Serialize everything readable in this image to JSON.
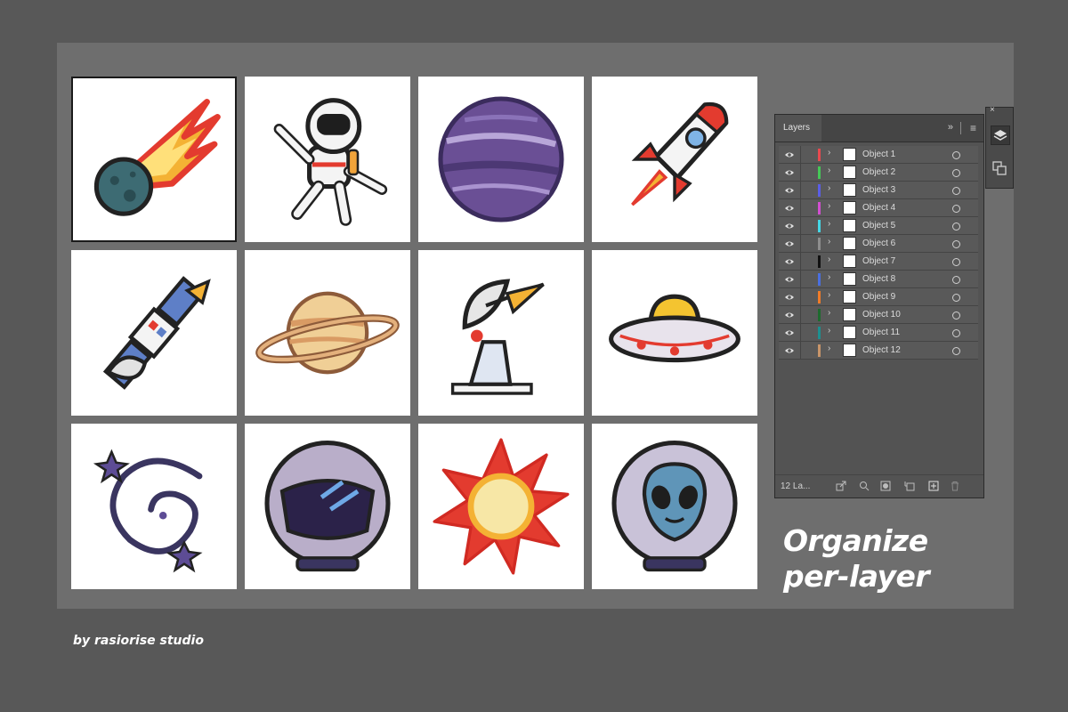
{
  "panel": {
    "tab_title": "Layers",
    "more_glyph": "»",
    "menu_glyph": "≡",
    "layer_count": "12 La...",
    "footer_icons": [
      "collect-export-icon",
      "locate-object-icon",
      "make-clipping-mask-icon",
      "new-sublayer-icon",
      "new-layer-icon",
      "delete-icon"
    ]
  },
  "layers": [
    {
      "name": "Object 1",
      "color": "#e8494f"
    },
    {
      "name": "Object 2",
      "color": "#45c857"
    },
    {
      "name": "Object 3",
      "color": "#5a5ee6"
    },
    {
      "name": "Object 4",
      "color": "#d24fd1"
    },
    {
      "name": "Object 5",
      "color": "#44d7e6"
    },
    {
      "name": "Object 6",
      "color": "#8e8e8e"
    },
    {
      "name": "Object 7",
      "color": "#111111"
    },
    {
      "name": "Object 8",
      "color": "#4a6fe0"
    },
    {
      "name": "Object 9",
      "color": "#f07b28"
    },
    {
      "name": "Object 10",
      "color": "#1e6b2e"
    },
    {
      "name": "Object 11",
      "color": "#1d8f8f"
    },
    {
      "name": "Object 12",
      "color": "#c8956a"
    }
  ],
  "artboards": [
    {
      "subject": "comet-icon",
      "selected": true
    },
    {
      "subject": "astronaut-icon",
      "selected": false
    },
    {
      "subject": "purple-planet-icon",
      "selected": false
    },
    {
      "subject": "rocket-icon",
      "selected": false
    },
    {
      "subject": "satellite-icon",
      "selected": false
    },
    {
      "subject": "ringed-planet-icon",
      "selected": false
    },
    {
      "subject": "radar-dish-icon",
      "selected": false
    },
    {
      "subject": "ufo-icon",
      "selected": false
    },
    {
      "subject": "galaxy-icon",
      "selected": false
    },
    {
      "subject": "space-helmet-icon",
      "selected": false
    },
    {
      "subject": "sun-icon",
      "selected": false
    },
    {
      "subject": "alien-helmet-icon",
      "selected": false
    }
  ],
  "dock": {
    "close_glyph": "×",
    "icons": [
      "layers-icon",
      "artboards-icon"
    ]
  },
  "headline": {
    "line1": "Organize",
    "line2": "per-layer"
  },
  "credit": "by rasiorise studio"
}
